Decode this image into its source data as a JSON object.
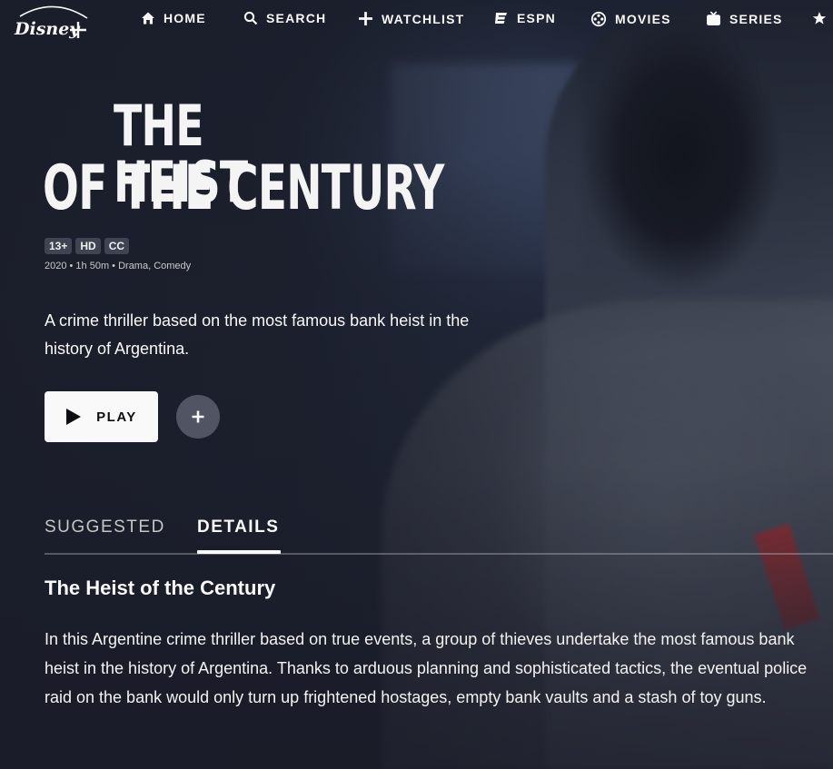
{
  "brand": {
    "logo_text": "Disney+"
  },
  "nav": {
    "items": [
      {
        "label": "HOME",
        "icon": "home-icon"
      },
      {
        "label": "SEARCH",
        "icon": "search-icon"
      },
      {
        "label": "WATCHLIST",
        "icon": "plus-icon"
      },
      {
        "label": "ESPN",
        "icon": "espn-icon"
      },
      {
        "label": "MOVIES",
        "icon": "film-reel-icon"
      },
      {
        "label": "SERIES",
        "icon": "tv-icon"
      }
    ],
    "overflow_icon": "star-icon"
  },
  "title": {
    "line1": "THE HEIST",
    "line2": "OF THE CENTURY"
  },
  "badges": [
    "13+",
    "HD",
    "CC"
  ],
  "meta": "2020 • 1h 50m • Drama, Comedy",
  "tagline": "A crime thriller based on the most famous bank heist in the history of Argentina.",
  "actions": {
    "play_label": "PLAY",
    "play_icon": "play-icon",
    "add_icon": "plus-icon"
  },
  "tabs": [
    {
      "label": "SUGGESTED",
      "active": false
    },
    {
      "label": "DETAILS",
      "active": true
    }
  ],
  "details": {
    "title": "The Heist of the Century",
    "description": "In this Argentine crime thriller based on true events, a group of thieves undertake the most famous bank heist in the history of Argentina. Thanks to arduous planning and sophisticated tactics, the eventual police raid on the bank would only turn up frightened hostages, empty bank vaults and a stash of toy guns."
  },
  "colors": {
    "background": "#1a1d29",
    "text": "#f9f9f9",
    "play_button_bg": "#f9f9f9",
    "accent_tie": "#962d32"
  }
}
